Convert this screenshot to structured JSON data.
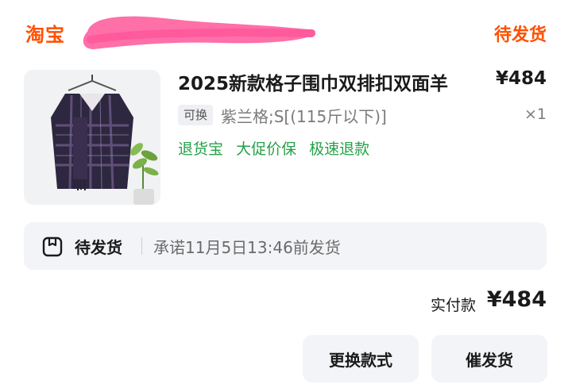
{
  "shop": {
    "name": "淘宝"
  },
  "order": {
    "status": "待发货"
  },
  "product": {
    "title": "2025新款格子围巾双排扣双面羊",
    "price": "¥484",
    "exchange_tag": "可换",
    "sku": "紫兰格;S[(115斤以下)]",
    "quantity": "×1",
    "service_tags": [
      "退货宝",
      "大促价保",
      "极速退款"
    ],
    "image_icon": "scarf-coat-photo"
  },
  "shipping": {
    "status": "待发货",
    "promise": "承诺11月5日13:46前发货",
    "icon": "package-box-icon"
  },
  "payment": {
    "label": "实付款",
    "amount": "¥484"
  },
  "actions": {
    "change_style": "更换款式",
    "urge_ship": "催发货"
  },
  "colors": {
    "brand": "#ff5000",
    "service_green": "#24a148",
    "panel_bg": "#f2f4f7",
    "redaction": "#ff6fa8"
  }
}
